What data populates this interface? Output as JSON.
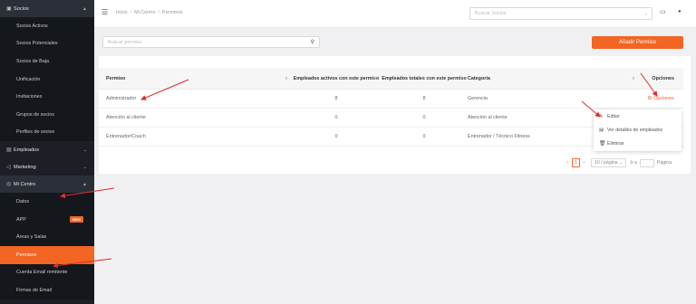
{
  "sidebar": {
    "socios_header": "Socios",
    "socios_items": [
      "Socios Activos",
      "Socios Potenciales",
      "Socios de Baja",
      "Unificación",
      "Invitaciones",
      "Grupos de socios",
      "Perfiles de socios"
    ],
    "empleados": "Empleados",
    "marketing": "Marketing",
    "mi_centro": "Mi Centro",
    "mi_centro_items": [
      "Datos",
      "APP",
      "Áreas y Salas",
      "Permisos",
      "Cuenta Email remitente",
      "Firmas de Email"
    ],
    "new_badge": "NEW",
    "accent": "#f26522"
  },
  "topbar": {
    "breadcrumb": [
      "Inicio",
      "Mi Centro",
      "Permisos"
    ],
    "search_placeholder": "Buscar Socios"
  },
  "toolbar": {
    "search_placeholder": "Buscar permiso",
    "add_button": "Añadir Permiso"
  },
  "table": {
    "headers": [
      "Permiso",
      "Empleados activos con este permiso",
      "Empleados totales con este permiso",
      "Categoría",
      "Opciones"
    ],
    "rows": [
      {
        "permiso": "Administrador",
        "activos": "8",
        "totales": "8",
        "categoria": "Gerencia",
        "opciones": "Opciones"
      },
      {
        "permiso": "Atención al cliente",
        "activos": "0",
        "totales": "0",
        "categoria": "Atención al cliente"
      },
      {
        "permiso": "Entrenador/Coach",
        "activos": "0",
        "totales": "0",
        "categoria": "Entrenador / Técnico Fitness"
      }
    ]
  },
  "dropdown": {
    "items": [
      "Editar",
      "Ver detalles de empleados",
      "Eliminar"
    ]
  },
  "pagination": {
    "current_page": "1",
    "page_size": "10 / página",
    "goto_label": "Ir a",
    "page_label": "Página"
  }
}
